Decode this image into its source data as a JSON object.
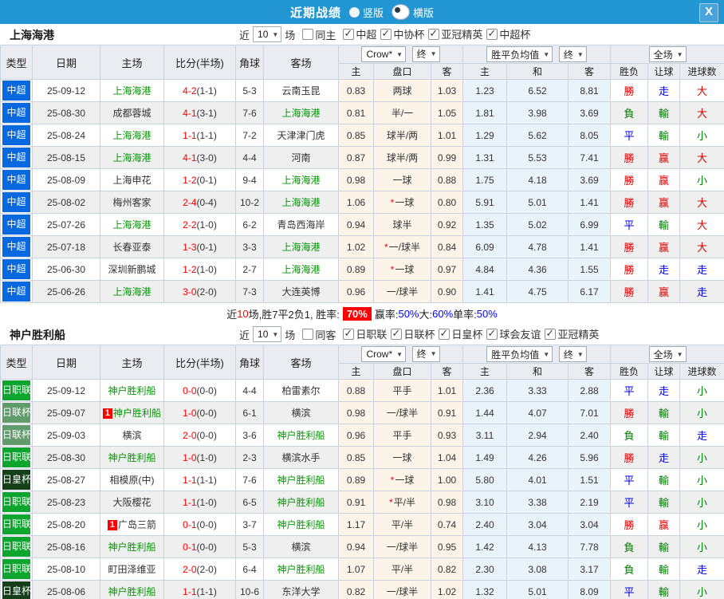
{
  "titlebar": {
    "title": "近期战绩",
    "close": "X",
    "radios": [
      {
        "label": "竖版",
        "selected": false
      },
      {
        "label": "横版",
        "selected": true
      }
    ]
  },
  "header": {
    "col_type": "类型",
    "col_date": "日期",
    "col_home": "主场",
    "col_score": "比分(半场)",
    "col_corner": "角球",
    "col_away": "客场",
    "dd_company": "Crow*",
    "dd_final1": "终",
    "dd_avg": "胜平负均值",
    "dd_final2": "终",
    "dd_scope": "全场",
    "sub": [
      "主",
      "盘口",
      "客",
      "主",
      "和",
      "客",
      "胜负",
      "让球",
      "进球数"
    ]
  },
  "league_colors": {
    "中超": "#0768df",
    "日职联": "#0da52e",
    "日联杯": "#619b6b",
    "日皇杯": "#143f18"
  },
  "result_colors": {
    "r": "#e60000",
    "g": "#008000",
    "b": "#0000dd"
  },
  "tables": [
    {
      "team": "上海海港",
      "filter": {
        "near": "近",
        "count": "10",
        "games": "场",
        "same": {
          "label": "同主",
          "checked": false
        },
        "leagues": [
          {
            "label": "中超",
            "checked": true
          },
          {
            "label": "中协杯",
            "checked": true
          },
          {
            "label": "亚冠精英",
            "checked": true
          },
          {
            "label": "中超杯",
            "checked": true
          }
        ]
      },
      "rows": [
        {
          "league": "中超",
          "date": "25-09-12",
          "home": "上海海港",
          "home_self": true,
          "home_card": false,
          "score": "4-2",
          "half": "(1-1)",
          "corner": "5-3",
          "away": "云南玉昆",
          "away_self": false,
          "o_home": "0.83",
          "handicap": "两球",
          "star": false,
          "o_away": "1.03",
          "avg_win": "1.23",
          "avg_draw": "6.52",
          "avg_lose": "8.81",
          "res_wdl": "勝",
          "res_wdl_c": "r",
          "res_handicap": "走",
          "res_handicap_c": "b",
          "res_goals": "大",
          "res_goals_c": "r"
        },
        {
          "league": "中超",
          "date": "25-08-30",
          "home": "成都蓉城",
          "home_self": false,
          "home_card": false,
          "score": "4-1",
          "half": "(3-1)",
          "corner": "7-6",
          "away": "上海海港",
          "away_self": true,
          "o_home": "0.81",
          "handicap": "半/一",
          "star": false,
          "o_away": "1.05",
          "avg_win": "1.81",
          "avg_draw": "3.98",
          "avg_lose": "3.69",
          "res_wdl": "負",
          "res_wdl_c": "g",
          "res_handicap": "輸",
          "res_handicap_c": "g",
          "res_goals": "大",
          "res_goals_c": "r"
        },
        {
          "league": "中超",
          "date": "25-08-24",
          "home": "上海海港",
          "home_self": true,
          "home_card": false,
          "score": "1-1",
          "half": "(1-1)",
          "corner": "7-2",
          "away": "天津津门虎",
          "away_self": false,
          "o_home": "0.85",
          "handicap": "球半/两",
          "star": false,
          "o_away": "1.01",
          "avg_win": "1.29",
          "avg_draw": "5.62",
          "avg_lose": "8.05",
          "res_wdl": "平",
          "res_wdl_c": "b",
          "res_handicap": "輸",
          "res_handicap_c": "g",
          "res_goals": "小",
          "res_goals_c": "g"
        },
        {
          "league": "中超",
          "date": "25-08-15",
          "home": "上海海港",
          "home_self": true,
          "home_card": false,
          "score": "4-1",
          "half": "(3-0)",
          "corner": "4-4",
          "away": "河南",
          "away_self": false,
          "o_home": "0.87",
          "handicap": "球半/两",
          "star": false,
          "o_away": "0.99",
          "avg_win": "1.31",
          "avg_draw": "5.53",
          "avg_lose": "7.41",
          "res_wdl": "勝",
          "res_wdl_c": "r",
          "res_handicap": "赢",
          "res_handicap_c": "r",
          "res_goals": "大",
          "res_goals_c": "r"
        },
        {
          "league": "中超",
          "date": "25-08-09",
          "home": "上海申花",
          "home_self": false,
          "home_card": false,
          "score": "1-2",
          "half": "(0-1)",
          "corner": "9-4",
          "away": "上海海港",
          "away_self": true,
          "o_home": "0.98",
          "handicap": "一球",
          "star": false,
          "o_away": "0.88",
          "avg_win": "1.75",
          "avg_draw": "4.18",
          "avg_lose": "3.69",
          "res_wdl": "勝",
          "res_wdl_c": "r",
          "res_handicap": "赢",
          "res_handicap_c": "r",
          "res_goals": "小",
          "res_goals_c": "g"
        },
        {
          "league": "中超",
          "date": "25-08-02",
          "home": "梅州客家",
          "home_self": false,
          "home_card": false,
          "score": "2-4",
          "half": "(0-4)",
          "corner": "10-2",
          "away": "上海海港",
          "away_self": true,
          "o_home": "1.06",
          "handicap": "一球",
          "star": true,
          "o_away": "0.80",
          "avg_win": "5.91",
          "avg_draw": "5.01",
          "avg_lose": "1.41",
          "res_wdl": "勝",
          "res_wdl_c": "r",
          "res_handicap": "赢",
          "res_handicap_c": "r",
          "res_goals": "大",
          "res_goals_c": "r"
        },
        {
          "league": "中超",
          "date": "25-07-26",
          "home": "上海海港",
          "home_self": true,
          "home_card": false,
          "score": "2-2",
          "half": "(1-0)",
          "corner": "6-2",
          "away": "青岛西海岸",
          "away_self": false,
          "o_home": "0.94",
          "handicap": "球半",
          "star": false,
          "o_away": "0.92",
          "avg_win": "1.35",
          "avg_draw": "5.02",
          "avg_lose": "6.99",
          "res_wdl": "平",
          "res_wdl_c": "b",
          "res_handicap": "輸",
          "res_handicap_c": "g",
          "res_goals": "大",
          "res_goals_c": "r"
        },
        {
          "league": "中超",
          "date": "25-07-18",
          "home": "长春亚泰",
          "home_self": false,
          "home_card": false,
          "score": "1-3",
          "half": "(0-1)",
          "corner": "3-3",
          "away": "上海海港",
          "away_self": true,
          "o_home": "1.02",
          "handicap": "一/球半",
          "star": true,
          "o_away": "0.84",
          "avg_win": "6.09",
          "avg_draw": "4.78",
          "avg_lose": "1.41",
          "res_wdl": "勝",
          "res_wdl_c": "r",
          "res_handicap": "赢",
          "res_handicap_c": "r",
          "res_goals": "大",
          "res_goals_c": "r"
        },
        {
          "league": "中超",
          "date": "25-06-30",
          "home": "深圳新鹏城",
          "home_self": false,
          "home_card": false,
          "score": "1-2",
          "half": "(1-0)",
          "corner": "2-7",
          "away": "上海海港",
          "away_self": true,
          "o_home": "0.89",
          "handicap": "一球",
          "star": true,
          "o_away": "0.97",
          "avg_win": "4.84",
          "avg_draw": "4.36",
          "avg_lose": "1.55",
          "res_wdl": "勝",
          "res_wdl_c": "r",
          "res_handicap": "走",
          "res_handicap_c": "b",
          "res_goals": "走",
          "res_goals_c": "b"
        },
        {
          "league": "中超",
          "date": "25-06-26",
          "home": "上海海港",
          "home_self": true,
          "home_card": false,
          "score": "3-0",
          "half": "(2-0)",
          "corner": "7-3",
          "away": "大连英博",
          "away_self": false,
          "o_home": "0.96",
          "handicap": "一/球半",
          "star": false,
          "o_away": "0.90",
          "avg_win": "1.41",
          "avg_draw": "4.75",
          "avg_lose": "6.17",
          "res_wdl": "勝",
          "res_wdl_c": "r",
          "res_handicap": "赢",
          "res_handicap_c": "r",
          "res_goals": "走",
          "res_goals_c": "b"
        }
      ],
      "summary": [
        {
          "t": "近"
        },
        {
          "t": "10",
          "s": "r"
        },
        {
          "t": "场,胜7平2负1, 胜率:"
        },
        {
          "t": "70%",
          "s": "badge"
        },
        {
          "t": "赢率:"
        },
        {
          "t": "50%",
          "s": "b"
        },
        {
          "t": " 大:"
        },
        {
          "t": "60%",
          "s": "b"
        },
        {
          "t": " 单率:"
        },
        {
          "t": "50%",
          "s": "b"
        }
      ]
    },
    {
      "team": "神户胜利船",
      "filter": {
        "near": "近",
        "count": "10",
        "games": "场",
        "same": {
          "label": "同客",
          "checked": false
        },
        "leagues": [
          {
            "label": "日职联",
            "checked": true
          },
          {
            "label": "日联杯",
            "checked": true
          },
          {
            "label": "日皇杯",
            "checked": true
          },
          {
            "label": "球会友谊",
            "checked": true
          },
          {
            "label": "亚冠精英",
            "checked": true
          }
        ]
      },
      "rows": [
        {
          "league": "日职联",
          "date": "25-09-12",
          "home": "神户胜利船",
          "home_self": true,
          "home_card": false,
          "score": "0-0",
          "half": "(0-0)",
          "corner": "4-4",
          "away": "柏雷素尔",
          "away_self": false,
          "o_home": "0.88",
          "handicap": "平手",
          "star": false,
          "o_away": "1.01",
          "avg_win": "2.36",
          "avg_draw": "3.33",
          "avg_lose": "2.88",
          "res_wdl": "平",
          "res_wdl_c": "b",
          "res_handicap": "走",
          "res_handicap_c": "b",
          "res_goals": "小",
          "res_goals_c": "g"
        },
        {
          "league": "日联杯",
          "date": "25-09-07",
          "home": "神户胜利船",
          "home_self": true,
          "home_card": true,
          "score": "1-0",
          "half": "(0-0)",
          "corner": "6-1",
          "away": "横滨",
          "away_self": false,
          "o_home": "0.98",
          "handicap": "一/球半",
          "star": false,
          "o_away": "0.91",
          "avg_win": "1.44",
          "avg_draw": "4.07",
          "avg_lose": "7.01",
          "res_wdl": "勝",
          "res_wdl_c": "r",
          "res_handicap": "輸",
          "res_handicap_c": "g",
          "res_goals": "小",
          "res_goals_c": "g"
        },
        {
          "league": "日联杯",
          "date": "25-09-03",
          "home": "横滨",
          "home_self": false,
          "home_card": false,
          "score": "2-0",
          "half": "(0-0)",
          "corner": "3-6",
          "away": "神户胜利船",
          "away_self": true,
          "o_home": "0.96",
          "handicap": "平手",
          "star": false,
          "o_away": "0.93",
          "avg_win": "3.11",
          "avg_draw": "2.94",
          "avg_lose": "2.40",
          "res_wdl": "負",
          "res_wdl_c": "g",
          "res_handicap": "輸",
          "res_handicap_c": "g",
          "res_goals": "走",
          "res_goals_c": "b"
        },
        {
          "league": "日职联",
          "date": "25-08-30",
          "home": "神户胜利船",
          "home_self": true,
          "home_card": false,
          "score": "1-0",
          "half": "(1-0)",
          "corner": "2-3",
          "away": "横滨水手",
          "away_self": false,
          "o_home": "0.85",
          "handicap": "一球",
          "star": false,
          "o_away": "1.04",
          "avg_win": "1.49",
          "avg_draw": "4.26",
          "avg_lose": "5.96",
          "res_wdl": "勝",
          "res_wdl_c": "r",
          "res_handicap": "走",
          "res_handicap_c": "b",
          "res_goals": "小",
          "res_goals_c": "g"
        },
        {
          "league": "日皇杯",
          "date": "25-08-27",
          "home": "相模原(中)",
          "home_self": false,
          "home_card": false,
          "score": "1-1",
          "half": "(1-1)",
          "corner": "7-6",
          "away": "神户胜利船",
          "away_self": true,
          "o_home": "0.89",
          "handicap": "一球",
          "star": true,
          "o_away": "1.00",
          "avg_win": "5.80",
          "avg_draw": "4.01",
          "avg_lose": "1.51",
          "res_wdl": "平",
          "res_wdl_c": "b",
          "res_handicap": "輸",
          "res_handicap_c": "g",
          "res_goals": "小",
          "res_goals_c": "g"
        },
        {
          "league": "日职联",
          "date": "25-08-23",
          "home": "大阪樱花",
          "home_self": false,
          "home_card": false,
          "score": "1-1",
          "half": "(1-0)",
          "corner": "6-5",
          "away": "神户胜利船",
          "away_self": true,
          "o_home": "0.91",
          "handicap": "平/半",
          "star": true,
          "o_away": "0.98",
          "avg_win": "3.10",
          "avg_draw": "3.38",
          "avg_lose": "2.19",
          "res_wdl": "平",
          "res_wdl_c": "b",
          "res_handicap": "輸",
          "res_handicap_c": "g",
          "res_goals": "小",
          "res_goals_c": "g"
        },
        {
          "league": "日职联",
          "date": "25-08-20",
          "home": "广岛三箭",
          "home_self": false,
          "home_card": true,
          "score": "0-1",
          "half": "(0-0)",
          "corner": "3-7",
          "away": "神户胜利船",
          "away_self": true,
          "o_home": "1.17",
          "handicap": "平/半",
          "star": false,
          "o_away": "0.74",
          "avg_win": "2.40",
          "avg_draw": "3.04",
          "avg_lose": "3.04",
          "res_wdl": "勝",
          "res_wdl_c": "r",
          "res_handicap": "赢",
          "res_handicap_c": "r",
          "res_goals": "小",
          "res_goals_c": "g"
        },
        {
          "league": "日职联",
          "date": "25-08-16",
          "home": "神户胜利船",
          "home_self": true,
          "home_card": false,
          "score": "0-1",
          "half": "(0-0)",
          "corner": "5-3",
          "away": "横滨",
          "away_self": false,
          "o_home": "0.94",
          "handicap": "一/球半",
          "star": false,
          "o_away": "0.95",
          "avg_win": "1.42",
          "avg_draw": "4.13",
          "avg_lose": "7.78",
          "res_wdl": "負",
          "res_wdl_c": "g",
          "res_handicap": "輸",
          "res_handicap_c": "g",
          "res_goals": "小",
          "res_goals_c": "g"
        },
        {
          "league": "日职联",
          "date": "25-08-10",
          "home": "町田泽维亚",
          "home_self": false,
          "home_card": false,
          "score": "2-0",
          "half": "(2-0)",
          "corner": "6-4",
          "away": "神户胜利船",
          "away_self": true,
          "o_home": "1.07",
          "handicap": "平/半",
          "star": false,
          "o_away": "0.82",
          "avg_win": "2.30",
          "avg_draw": "3.08",
          "avg_lose": "3.17",
          "res_wdl": "負",
          "res_wdl_c": "g",
          "res_handicap": "輸",
          "res_handicap_c": "g",
          "res_goals": "走",
          "res_goals_c": "b"
        },
        {
          "league": "日皇杯",
          "date": "25-08-06",
          "home": "神户胜利船",
          "home_self": true,
          "home_card": false,
          "score": "1-1",
          "half": "(1-1)",
          "corner": "10-6",
          "away": "东洋大学",
          "away_self": false,
          "o_home": "0.82",
          "handicap": "一/球半",
          "star": false,
          "o_away": "1.02",
          "avg_win": "1.32",
          "avg_draw": "5.01",
          "avg_lose": "8.09",
          "res_wdl": "平",
          "res_wdl_c": "b",
          "res_handicap": "輸",
          "res_handicap_c": "g",
          "res_goals": "小",
          "res_goals_c": "g"
        }
      ],
      "summary": null
    }
  ]
}
